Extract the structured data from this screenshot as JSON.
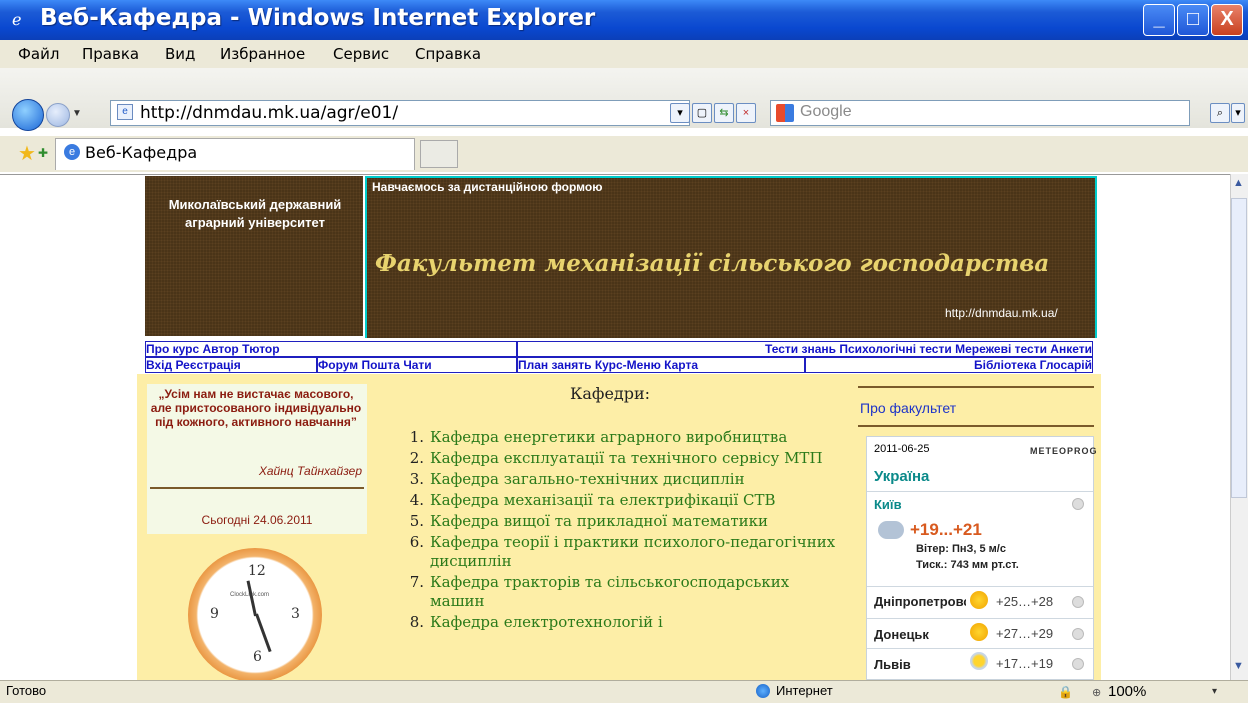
{
  "window": {
    "title": "Веб-Кафедра - Windows Internet Explorer",
    "min": "_",
    "max": "□",
    "close": "X"
  },
  "menu": [
    "Файл",
    "Правка",
    "Вид",
    "Избранное",
    "Сервис",
    "Справка"
  ],
  "address": {
    "url": "http://dnmdau.mk.ua/agr/e01/"
  },
  "search": {
    "placeholder": "Google"
  },
  "tab": {
    "label": "Веб-Кафедра"
  },
  "banner": {
    "university": "Миколаївський державний аграрний університет",
    "subtitle": "Навчаємось за дистанційною формою",
    "faculty": "Факультет механізації сільського господарства",
    "site": "http://dnmdau.mk.ua/"
  },
  "nav": {
    "row1_left": "Про курс  Автор  Тютор",
    "row1_right": "Тести знань  Психологічні тести  Мережеві тести  Анкети",
    "row2_a": "Вхід  Реєстрація",
    "row2_b": "Форум  Пошта  Чати",
    "row2_c": "План занять  Курс-Меню  Карта",
    "row2_d": "Бібліотека  Глосарій"
  },
  "quote": {
    "text": "„Усім нам не вистачає масового, але пристосованого індивідуально під кожного, активного навчання”",
    "author": "Хайнц Тайнхайзер",
    "today": "Сьогодні 24.06.2011"
  },
  "clock": {
    "brand": "ClockLink.com",
    "n12": "12",
    "n3": "3",
    "n6": "6",
    "n9": "9"
  },
  "departments": {
    "title": "Кафедри:",
    "items": [
      "Кафедра енергетики аграрного виробництва",
      "Кафедра експлуатації та технічного сервісу МТП",
      "Кафедра загально-технічних дисциплін",
      "Кафедра механізації та електрифікації СТВ",
      "Кафедра вищої та прикладної математики",
      "Кафедра теорії і практики психолого-педагогічних дисциплін",
      "Кафедра тракторів та сільськогосподарських машин",
      "Кафедра електротехнологій і"
    ]
  },
  "right": {
    "link": "Про факультет"
  },
  "weather": {
    "date": "2011-06-25",
    "brand": "METEOPROG",
    "country": "Україна",
    "city": "Київ",
    "temp": "+19...+21",
    "wind": "Вітер: ПнЗ, 5 м/с",
    "pressure": "Тиск.: 743 мм рт.ст.",
    "cities": [
      {
        "name": "Дніпропетровськ",
        "range": "+25…+28"
      },
      {
        "name": "Донецьк",
        "range": "+27…+29"
      },
      {
        "name": "Львів",
        "range": "+17…+19"
      }
    ]
  },
  "status": {
    "left": "Готово",
    "zone": "Интернет",
    "zoom": "100%"
  }
}
